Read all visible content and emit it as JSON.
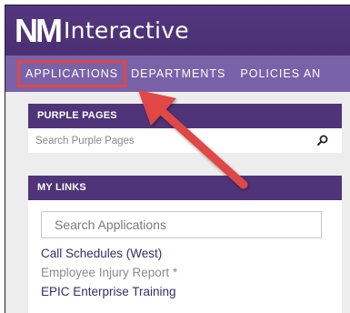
{
  "brand": {
    "mark": "NM",
    "name": "Interactive"
  },
  "nav": {
    "items": [
      {
        "label": "APPLICATIONS"
      },
      {
        "label": "DEPARTMENTS"
      },
      {
        "label": "POLICIES AN"
      }
    ],
    "highlight_color": "#e04644"
  },
  "purple_pages": {
    "title": "PURPLE PAGES",
    "search_placeholder": "Search Purple Pages"
  },
  "my_links": {
    "title": "MY LINKS",
    "search_placeholder": "Search Applications",
    "links": [
      {
        "label": "Call Schedules (West)",
        "state": "active"
      },
      {
        "label": "Employee Injury Report *",
        "state": "muted"
      },
      {
        "label": "EPIC Enterprise Training",
        "state": "active"
      }
    ]
  },
  "colors": {
    "header": "#4a2f73",
    "nav": "#7a62a8",
    "panel_header": "#4f3479",
    "annotation_arrow": "#e04644"
  }
}
